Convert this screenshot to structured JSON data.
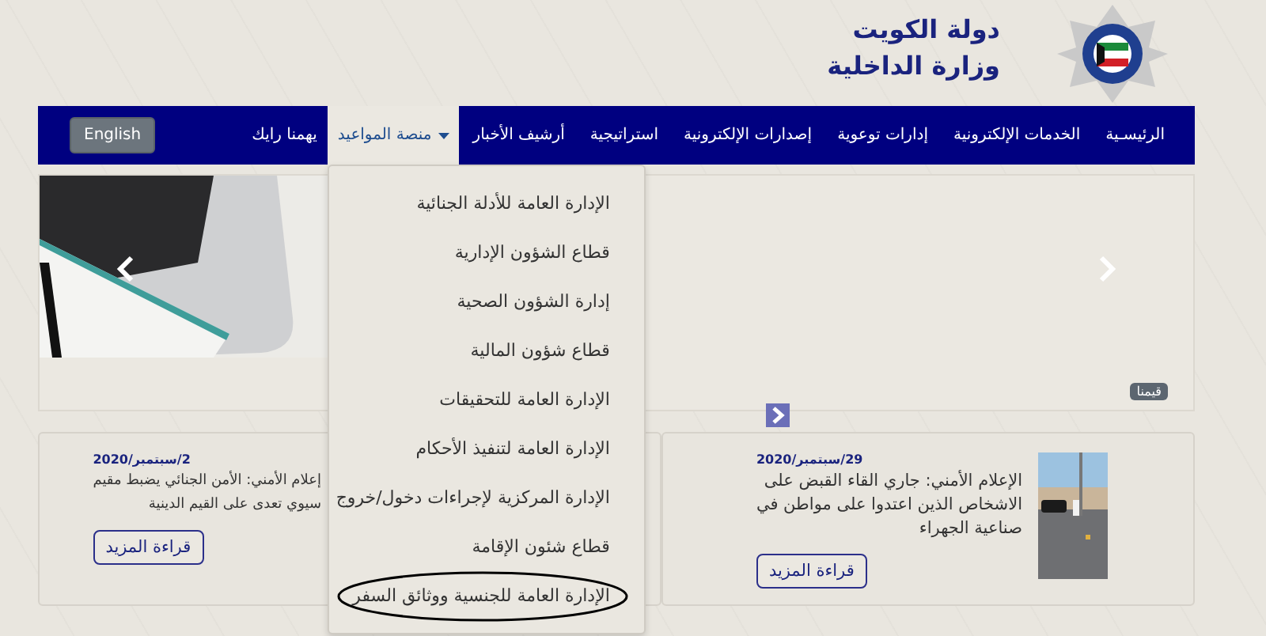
{
  "header": {
    "title_lines": [
      "دولة الكويت",
      "وزارة الداخلية"
    ]
  },
  "nav": {
    "items": [
      {
        "label": "الرئيسـية",
        "selected": false,
        "dropdown": false
      },
      {
        "label": "الخدمات الإلكترونية",
        "selected": false,
        "dropdown": false
      },
      {
        "label": "إدارات توعوية",
        "selected": false,
        "dropdown": false
      },
      {
        "label": "إصدارات الإلكترونية",
        "selected": false,
        "dropdown": false
      },
      {
        "label": "استراتيجية",
        "selected": false,
        "dropdown": false
      },
      {
        "label": "أرشيف الأخبار",
        "selected": false,
        "dropdown": false
      },
      {
        "label": "منصة المواعيد",
        "selected": true,
        "dropdown": true
      },
      {
        "label": "يهمنا رايك",
        "selected": false,
        "dropdown": false
      }
    ],
    "language_button": "English"
  },
  "dropdown": {
    "items": [
      {
        "label": "الإدارة العامة للأدلة الجنائية",
        "circled": false
      },
      {
        "label": "قطاع الشؤون الإدارية",
        "circled": false
      },
      {
        "label": "إدارة الشؤون الصحية",
        "circled": false
      },
      {
        "label": "قطاع شؤون المالية",
        "circled": false
      },
      {
        "label": "الإدارة العامة للتحقيقات",
        "circled": false
      },
      {
        "label": "الإدارة العامة لتنفيذ الأحكام",
        "circled": false
      },
      {
        "label": "الإدارة المركزية لإجراءات دخول/خروج",
        "circled": false
      },
      {
        "label": "قطاع شئون الإقامة",
        "circled": false
      },
      {
        "label": "الإدارة العامة للجنسية ووثائق السفر",
        "circled": true
      }
    ]
  },
  "slider": {
    "badge": "قيمنا"
  },
  "news": [
    {
      "kind": "picture",
      "date": "29/سبتمبر/2020",
      "lines": [
        "الإعلام الأمني: جاري القاء القبض على",
        "الاشخاص الذين اعتدوا على مواطن في",
        "صناعية الجهراء"
      ],
      "button": "قراءة المزيد"
    },
    {
      "kind": "text",
      "date": "2/سبتمبر/2020",
      "lines": [
        "إعلام الأمني: الأمن الجنائي يضبط مقيم",
        "سيوي تعدى على القيم الدينية"
      ],
      "button": "قراءة المزيد"
    }
  ]
}
